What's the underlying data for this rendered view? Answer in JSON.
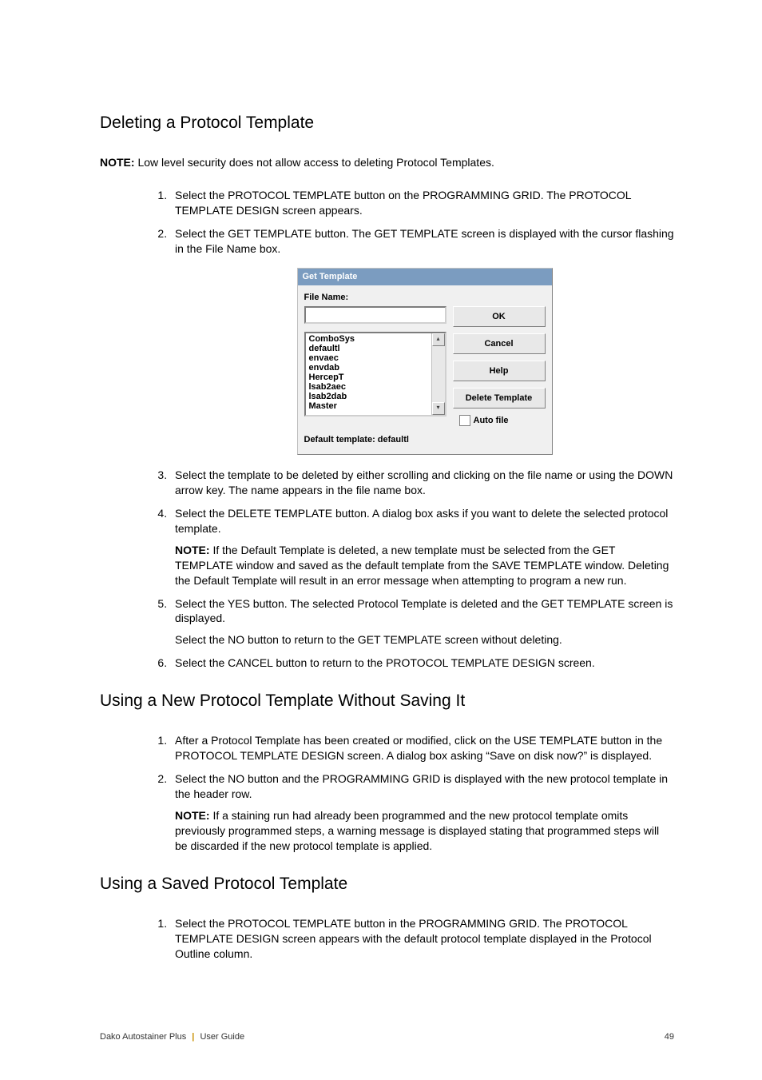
{
  "sections": {
    "s1": {
      "title": "Deleting a Protocol Template",
      "note_label": "NOTE:",
      "note_text": "  Low level security does not allow access to deleting Protocol Templates.",
      "steps": {
        "1": "Select the PROTOCOL TEMPLATE button on the PROGRAMMING GRID. The PROTOCOL TEMPLATE DESIGN screen appears.",
        "2": "Select the GET TEMPLATE button. The GET TEMPLATE screen is displayed with the cursor flashing in the File Name box.",
        "3": "Select the template to be deleted by either scrolling and clicking on the file name or using the DOWN arrow key. The name appears in the file name box.",
        "4a": "Select the DELETE TEMPLATE button. A dialog box asks if you want to delete the selected protocol template.",
        "4_note_label": "NOTE:",
        "4_note_text": "  If the Default Template is deleted, a new template must be selected from the GET TEMPLATE window and saved as the default template from the SAVE TEMPLATE window. Deleting the Default Template will result in an error message when attempting to program a new run.",
        "5a": "Select the YES button. The selected Protocol Template is deleted and the GET TEMPLATE screen is displayed.",
        "5b": "Select the NO button to return to the GET TEMPLATE screen without deleting.",
        "6": "Select the CANCEL button to return to the PROTOCOL TEMPLATE DESIGN screen."
      }
    },
    "s2": {
      "title": "Using a New Protocol Template Without Saving It",
      "steps": {
        "1": "After a Protocol Template has been created or modified, click on the USE TEMPLATE button in the PROTOCOL TEMPLATE DESIGN screen. A dialog box asking “Save on disk now?” is displayed.",
        "2a": "Select the NO button and the PROGRAMMING GRID is displayed with the new protocol template in the header row.",
        "2_note_label": "NOTE:",
        "2_note_text": "  If a staining run had already been programmed and the new protocol template omits previously programmed steps, a warning message is displayed stating that programmed steps will be discarded if the new protocol template is applied."
      }
    },
    "s3": {
      "title": "Using a Saved Protocol Template",
      "steps": {
        "1": "Select the PROTOCOL TEMPLATE button in the PROGRAMMING GRID. The PROTOCOL TEMPLATE DESIGN screen appears with the default protocol template displayed in the Protocol Outline column."
      }
    }
  },
  "dialog": {
    "title": "Get Template",
    "file_label": "File Name:",
    "items": [
      "ComboSys",
      "defaultl",
      "envaec",
      "envdab",
      "HercepT",
      "lsab2aec",
      "lsab2dab",
      "Master"
    ],
    "buttons": {
      "ok": "OK",
      "cancel": "Cancel",
      "help": "Help",
      "delete": "Delete Template"
    },
    "auto_file": "Auto file",
    "default_label": "Default template:",
    "default_value": "   defaultl"
  },
  "footer": {
    "product": "Dako Autostainer Plus",
    "sep": " | ",
    "doc": "User Guide",
    "page": "49"
  }
}
